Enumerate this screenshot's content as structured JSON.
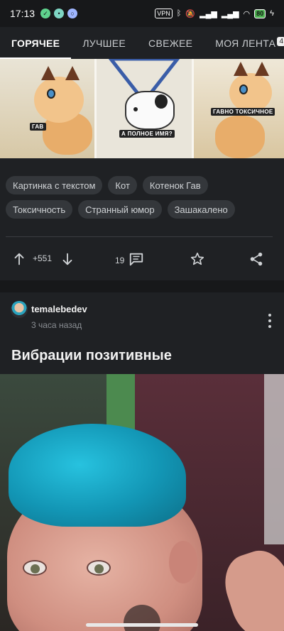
{
  "status": {
    "time": "17:13",
    "vpn": "VPN",
    "battery": "80"
  },
  "tabs": [
    {
      "label": "ГОРЯЧЕЕ"
    },
    {
      "label": "ЛУЧШЕЕ"
    },
    {
      "label": "СВЕЖЕЕ"
    },
    {
      "label": "МОЯ ЛЕНТА"
    }
  ],
  "tab_badge": "4",
  "meme": {
    "caption1": "ГАВ",
    "caption2": "А ПОЛНОЕ ИМЯ?",
    "caption3": "ГАВНО ТОКСИЧНОЕ"
  },
  "tags": [
    "Картинка с текстом",
    "Кот",
    "Котенок Гав",
    "Токсичность",
    "Странный юмор",
    "Зашакалено"
  ],
  "actions": {
    "rating": "+551",
    "comments": "19"
  },
  "post": {
    "author": "temalebedev",
    "time_ago": "3 часа назад",
    "title": "Вибрации позитивные"
  },
  "icons": {
    "upvote": "arrow-up-icon",
    "downvote": "arrow-down-icon",
    "comments": "comment-icon",
    "save": "star-icon",
    "share": "share-icon",
    "more": "more-vertical-icon"
  },
  "colors": {
    "background": "#1f2124",
    "tag_bg": "#34373b",
    "accent": "#ffffff"
  }
}
